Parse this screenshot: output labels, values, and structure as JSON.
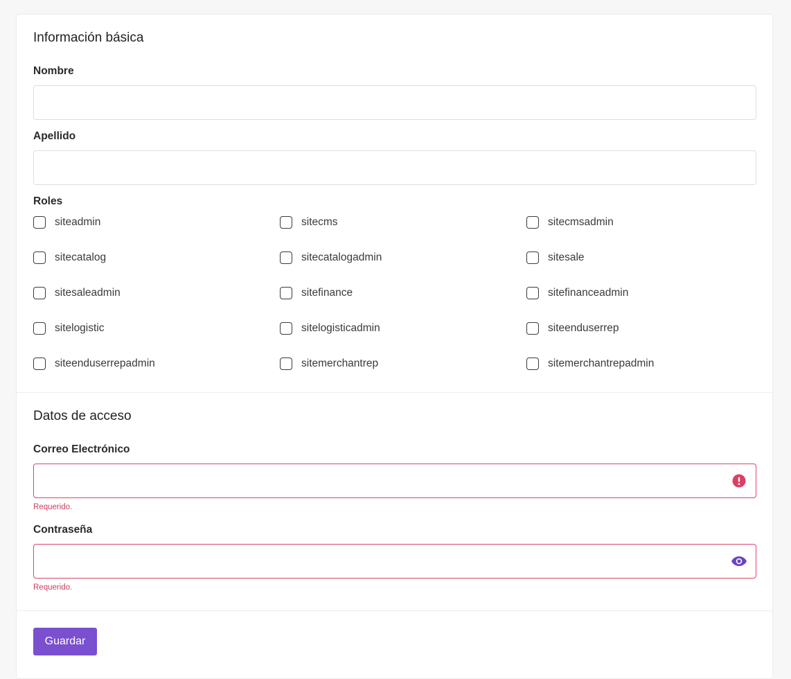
{
  "basic_info": {
    "title": "Información básica",
    "first_name": {
      "label": "Nombre",
      "value": "",
      "placeholder": ""
    },
    "last_name": {
      "label": "Apellido",
      "value": "",
      "placeholder": ""
    },
    "roles": {
      "label": "Roles",
      "items": [
        {
          "label": "siteadmin",
          "checked": false
        },
        {
          "label": "sitecms",
          "checked": false
        },
        {
          "label": "sitecmsadmin",
          "checked": false
        },
        {
          "label": "sitecatalog",
          "checked": false
        },
        {
          "label": "sitecatalogadmin",
          "checked": false
        },
        {
          "label": "sitesale",
          "checked": false
        },
        {
          "label": "sitesaleadmin",
          "checked": false
        },
        {
          "label": "sitefinance",
          "checked": false
        },
        {
          "label": "sitefinanceadmin",
          "checked": false
        },
        {
          "label": "sitelogistic",
          "checked": false
        },
        {
          "label": "sitelogisticadmin",
          "checked": false
        },
        {
          "label": "siteenduserrep",
          "checked": false
        },
        {
          "label": "siteenduserrepadmin",
          "checked": false
        },
        {
          "label": "sitemerchantrep",
          "checked": false
        },
        {
          "label": "sitemerchantrepadmin",
          "checked": false
        }
      ]
    }
  },
  "access_data": {
    "title": "Datos de acceso",
    "email": {
      "label": "Correo Electrónico",
      "value": "",
      "error": "Requerido.",
      "icon": "error-icon"
    },
    "password": {
      "label": "Contraseña",
      "value": "",
      "error": "Requerido.",
      "icon": "eye-icon"
    }
  },
  "actions": {
    "save_label": "Guardar"
  },
  "colors": {
    "primary": "#7a4fd0",
    "error": "#d9466b",
    "border": "#dedede"
  }
}
